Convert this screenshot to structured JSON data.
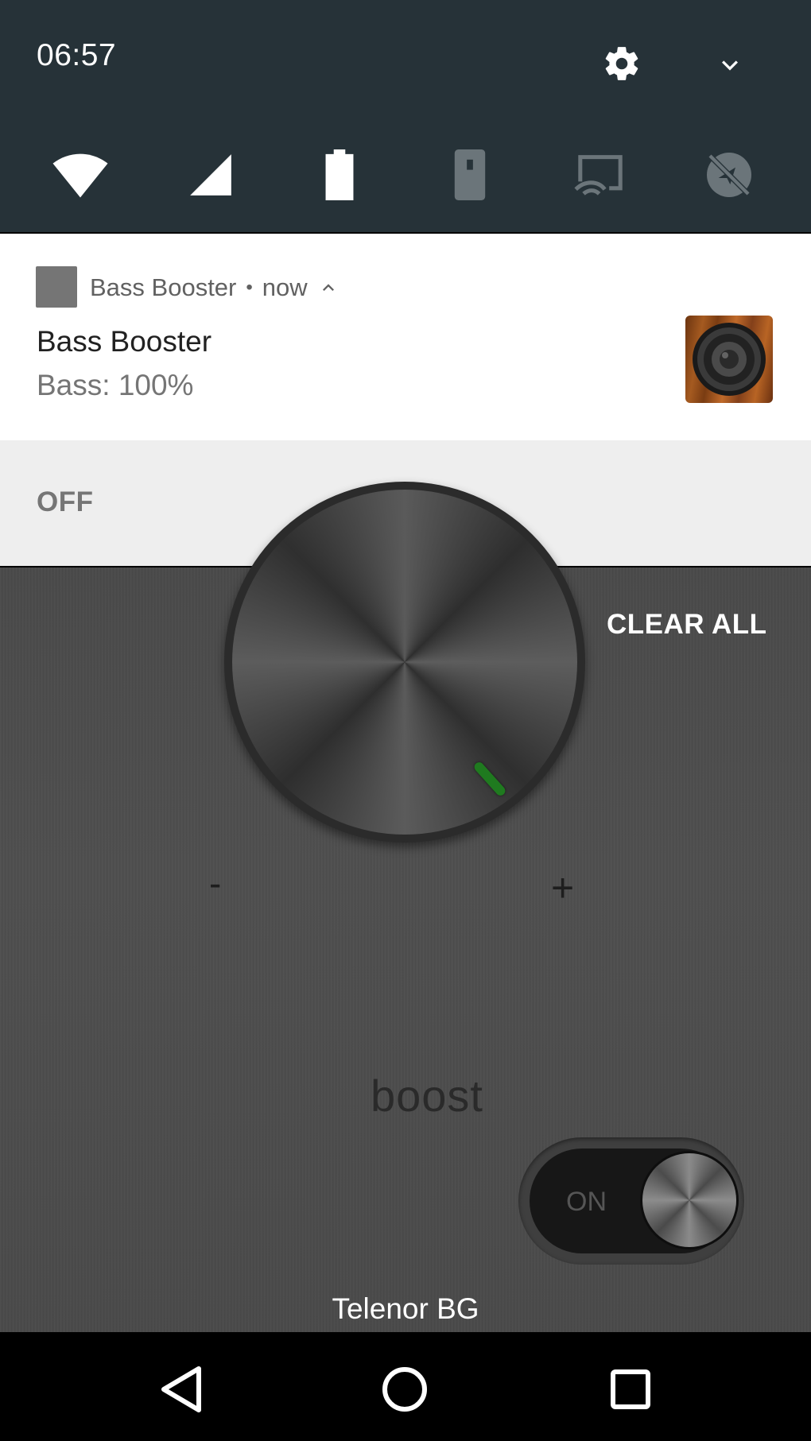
{
  "status": {
    "time": "06:57",
    "icons": [
      "settings-icon",
      "chevron-down-icon"
    ]
  },
  "quick_tiles": [
    {
      "name": "wifi-icon"
    },
    {
      "name": "cellular-signal-icon"
    },
    {
      "name": "battery-icon"
    },
    {
      "name": "flashlight-icon"
    },
    {
      "name": "cast-icon"
    },
    {
      "name": "location-off-icon"
    }
  ],
  "notification": {
    "app_name": "Bass Booster",
    "separator": "•",
    "time": "now",
    "title": "Bass Booster",
    "text": "Bass: 100%",
    "action": "OFF",
    "large_icon": "speaker-icon"
  },
  "app": {
    "clear_all": "CLEAR ALL",
    "minus": "-",
    "plus": "+",
    "boost_label": "boost",
    "switch_label": "ON",
    "carrier": "Telenor BG"
  },
  "navbar": {
    "buttons": [
      "back-icon",
      "home-icon",
      "recents-icon"
    ]
  },
  "colors": {
    "qs_background": "#263238",
    "notification_bg": "#ffffff",
    "action_bg": "#eeeeee",
    "indicator": "#1f7a1f"
  }
}
